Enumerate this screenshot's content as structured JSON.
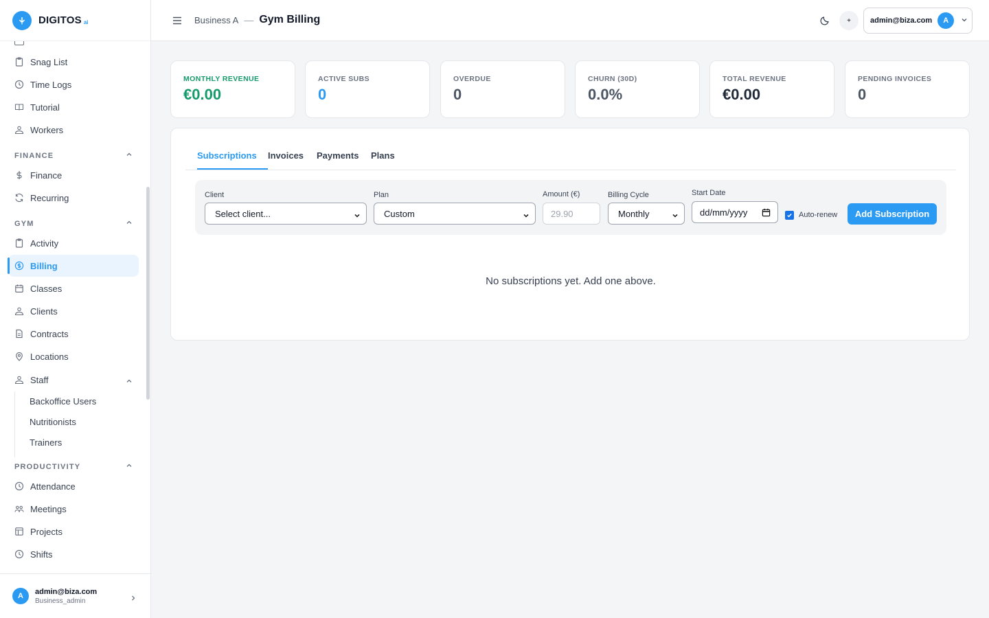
{
  "brand": {
    "name": "DIGITOS",
    "suffix": "ai"
  },
  "sidebar": {
    "items_top": [
      {
        "label": "Snag List",
        "icon": "clipboard-icon"
      },
      {
        "label": "Time Logs",
        "icon": "clock-icon"
      },
      {
        "label": "Tutorial",
        "icon": "book-icon"
      },
      {
        "label": "Workers",
        "icon": "people-icon"
      }
    ],
    "finance_section": "FINANCE",
    "finance_items": [
      {
        "label": "Finance",
        "icon": "dollar-icon"
      },
      {
        "label": "Recurring",
        "icon": "refresh-icon"
      }
    ],
    "gym_section": "GYM",
    "gym_items": [
      {
        "label": "Activity",
        "icon": "clipboard-icon"
      },
      {
        "label": "Billing",
        "icon": "dollar-circle-icon",
        "active": true
      },
      {
        "label": "Classes",
        "icon": "calendar-icon"
      },
      {
        "label": "Clients",
        "icon": "people-icon"
      },
      {
        "label": "Contracts",
        "icon": "document-icon"
      },
      {
        "label": "Locations",
        "icon": "map-pin-icon"
      },
      {
        "label": "Staff",
        "icon": "people-icon"
      }
    ],
    "staff_subitems": [
      "Backoffice Users",
      "Nutritionists",
      "Trainers"
    ],
    "productivity_section": "PRODUCTIVITY",
    "productivity_items": [
      {
        "label": "Attendance",
        "icon": "clock-icon"
      },
      {
        "label": "Meetings",
        "icon": "group-icon"
      },
      {
        "label": "Projects",
        "icon": "layout-icon"
      },
      {
        "label": "Shifts",
        "icon": "clock-icon"
      }
    ],
    "user": {
      "initial": "A",
      "email": "admin@biza.com",
      "role": "Business_admin"
    }
  },
  "header": {
    "business": "Business A",
    "separator": "—",
    "title": "Gym Billing",
    "plus": "+",
    "account": {
      "email": "admin@biza.com",
      "initial": "A"
    }
  },
  "stats": [
    {
      "label": "MONTHLY REVENUE",
      "value": "€0.00",
      "color": "#159a6b"
    },
    {
      "label": "ACTIVE SUBS",
      "value": "0",
      "color": "#2b9af3"
    },
    {
      "label": "OVERDUE",
      "value": "0",
      "color": "#4b5563"
    },
    {
      "label": "CHURN (30D)",
      "value": "0.0%",
      "color": "#4b5563"
    },
    {
      "label": "TOTAL REVENUE",
      "value": "€0.00",
      "color": "#1f2937"
    },
    {
      "label": "PENDING INVOICES",
      "value": "0",
      "color": "#4b5563"
    }
  ],
  "tabs": [
    "Subscriptions",
    "Invoices",
    "Payments",
    "Plans"
  ],
  "form": {
    "client_label": "Client",
    "client_value": "Select client...",
    "plan_label": "Plan",
    "plan_value": "Custom",
    "amount_label": "Amount (€)",
    "amount_placeholder": "29.90",
    "cycle_label": "Billing Cycle",
    "cycle_value": "Monthly",
    "start_label": "Start Date",
    "start_placeholder": "dd/mm/yyyy",
    "auto_renew_label": "Auto-renew",
    "auto_renew_checked": true,
    "submit_label": "Add Subscription"
  },
  "empty_state": "No subscriptions yet. Add one above.",
  "colors": {
    "accent": "#2b9af3",
    "success": "#159a6b"
  }
}
